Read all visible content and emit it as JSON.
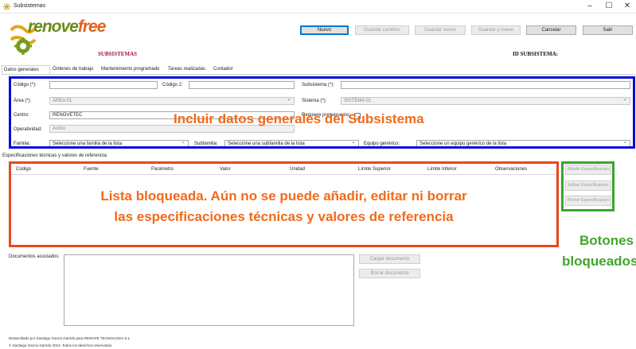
{
  "window": {
    "title": "Subsistemas",
    "controls": {
      "minimize": "–",
      "maximize": "☐",
      "close": "✕"
    }
  },
  "brand": {
    "logo_part1": "renove",
    "logo_part2": "free",
    "colors": {
      "green": "#6a8a18",
      "orange": "#e2601c"
    }
  },
  "header": {
    "title": "SUBSISTEMAS",
    "id_label": "ID SUBSISTEMA:"
  },
  "toolbar": {
    "nuevo": "Nuevo",
    "guardar_cambios": "Guardar cambios",
    "guardar_nuevo": "Guardar nuevo",
    "guardar_y_nuevo": "Guardar y nuevo",
    "cancelar": "Cancelar",
    "salir": "Salir"
  },
  "tabs": [
    "Datos generales",
    "Órdenes de trabajo",
    "Mantenimiento programado",
    "Tareas realizadas",
    "Contador"
  ],
  "form": {
    "codigo_label": "Código (*):",
    "codigo_value": "",
    "codigo2_label": "Código 2:",
    "codigo2_value": "",
    "subsistema_label": "Subsistema (*):",
    "subsistema_value": "",
    "area_label": "Área (*):",
    "area_value": "ÁREA 01",
    "sistema_label": "Sistema (*):",
    "sistema_value": "SISTEMA 01",
    "centro_label": "Centro:",
    "centro_value": "RENOVETEC",
    "requiere_label": "Requiere presupuesto:",
    "operatividad_label": "Operatividad:",
    "operatividad_value": "Activo",
    "familia_label": "Familia:",
    "familia_value": "Seleccione una familia de la lista",
    "subfamilia_label": "Subfamilia:",
    "subfamilia_value": "Seleccione una subfamilia de la lista",
    "equipo_label": "Equipo genérico:",
    "equipo_value": "Seleccione un equipo genérico de la lista"
  },
  "annotations": {
    "blue": "Incluir datos generales del Subsistema",
    "red_line1": "Lista bloqueada. Aún no se puede añadir, editar ni borrar",
    "red_line2": "las especificaciones técnicas y valores de referencia",
    "green_line1": "Botones",
    "green_line2": "bloqueados",
    "colors": {
      "blue_box": "#0a0adc",
      "red_box": "#e8481e",
      "green_box": "#39a52d",
      "text": "#f26a1b"
    }
  },
  "specs": {
    "label": "Especificaciones técnicas y valores de referencia:",
    "columns": [
      "Código",
      "Fuente",
      "Parámetro",
      "Valor",
      "Unidad",
      "Límite Superior",
      "Límite Inferior",
      "Observaciones"
    ],
    "add": "Añadir Especificación",
    "edit": "Editar Especificación",
    "delete": "Borrar Especificación"
  },
  "documents": {
    "label": "Documentos asociados:",
    "load": "Cargar documento",
    "delete": "Borrar documento"
  },
  "footer": {
    "line1": "Desarrollado por Santiago García Garrido para RENOVE TECNOLOGIA S.L.",
    "line2": "© Santiago García Garrido 2014. Todos los derechos reservados."
  }
}
